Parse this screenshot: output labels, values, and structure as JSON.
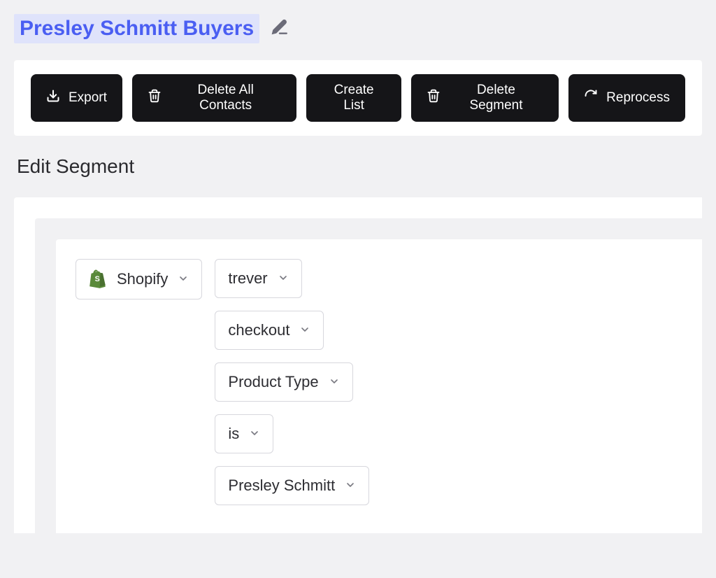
{
  "title": "Presley Schmitt Buyers",
  "toolbar": {
    "export": "Export",
    "delete_all": "Delete All Contacts",
    "create_list": "Create List",
    "delete_segment": "Delete Segment",
    "reprocess": "Reprocess"
  },
  "section_heading": "Edit Segment",
  "condition": {
    "source": "Shopify",
    "store": "trever",
    "event": "checkout",
    "attribute": "Product Type",
    "operator": "is",
    "value": "Presley Schmitt"
  }
}
